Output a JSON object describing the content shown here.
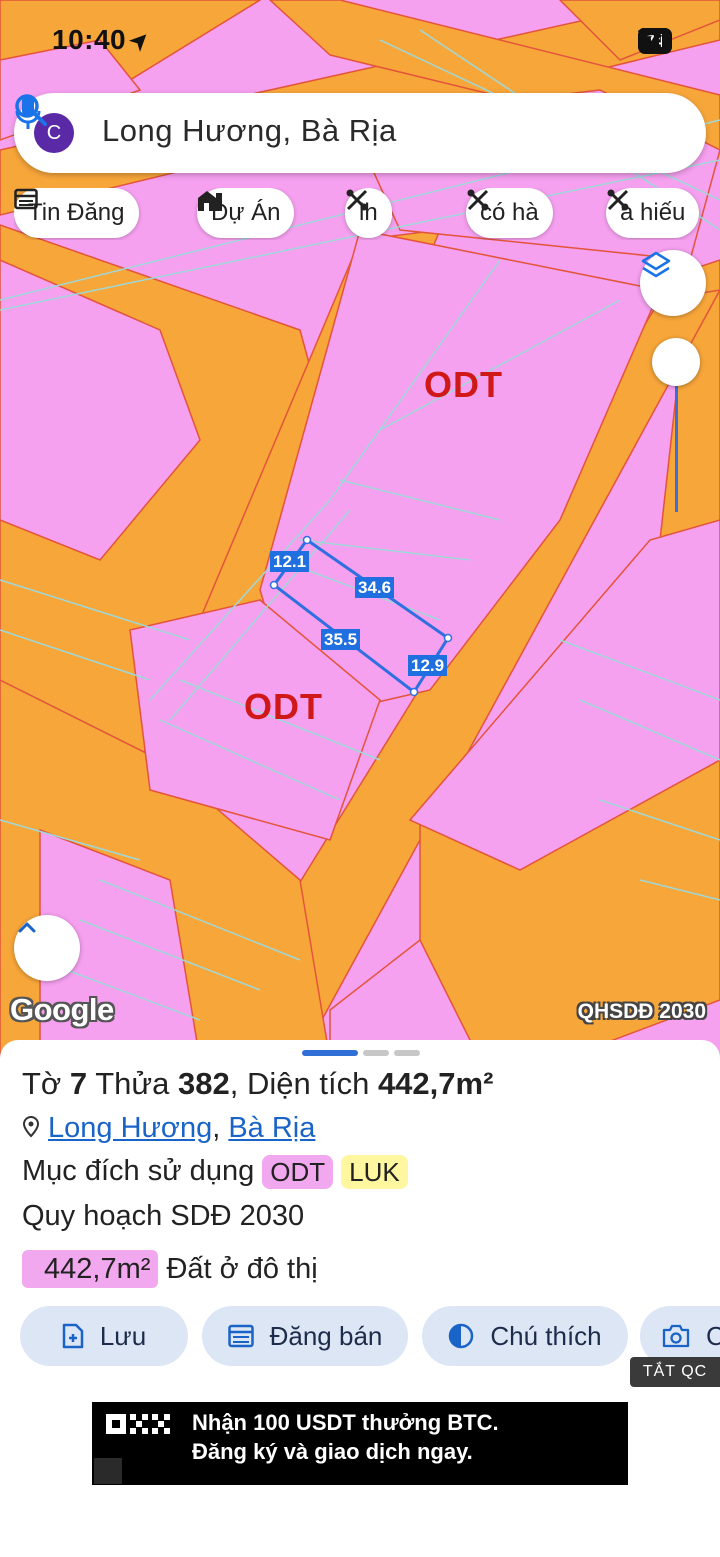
{
  "status_bar": {
    "time": "10:40",
    "battery": "74"
  },
  "search": {
    "avatar_letter": "C",
    "query": "Long Hương, Bà Rịa"
  },
  "chips": [
    {
      "label": "Tin Đăng",
      "icon": "calendar-list-icon"
    },
    {
      "label": "Dự Án",
      "icon": "building-icon"
    },
    {
      "label": "lh",
      "icon": "tools-icon"
    },
    {
      "label": "có hà",
      "icon": "tools-icon"
    },
    {
      "label": "a hiếu",
      "icon": "tools-icon"
    }
  ],
  "map": {
    "zone_labels": [
      "ODT",
      "ODT"
    ],
    "dimensions": {
      "top": "12.1",
      "right_top": "34.6",
      "left_bottom": "35.5",
      "right": "12.9"
    },
    "google": "Google",
    "layer_name": "QHSDĐ 2030",
    "colors": {
      "residential": "#f6a0f0",
      "road": "#f7a63a",
      "boundary": "#2f6fe0"
    }
  },
  "sheet": {
    "title": {
      "to_label": "Tờ",
      "to_value": "7",
      "thua_label": "Thửa",
      "thua_value": "382",
      "area_label": "Diện tích",
      "area_value": "442,7m²"
    },
    "location": {
      "ward": "Long Hương",
      "separator": ",",
      "city": "Bà Rịa"
    },
    "purpose_label": "Mục đích sử dụng",
    "purpose_tags": [
      "ODT",
      "LUK"
    ],
    "plan_label": "Quy hoạch SDĐ 2030",
    "area_detail": {
      "value": "442,7m²",
      "description": "Đất ở đô thị"
    },
    "actions": [
      {
        "label": "Lưu",
        "icon": "add-file-icon"
      },
      {
        "label": "Đăng bán",
        "icon": "calendar-list-icon"
      },
      {
        "label": "Chú thích",
        "icon": "contrast-icon"
      },
      {
        "label": "C",
        "icon": "camera-icon"
      }
    ]
  },
  "ad": {
    "close_label": "TẮT QC",
    "line1": "Nhận 100 USDT thưởng BTC.",
    "line2": "Đăng ký và giao dịch ngay."
  }
}
